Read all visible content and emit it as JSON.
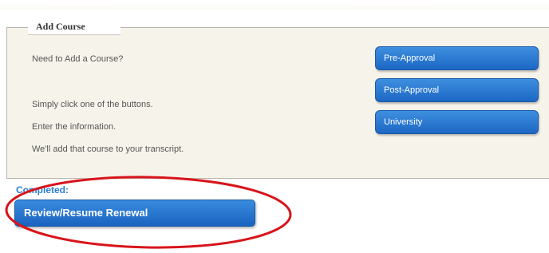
{
  "add_course": {
    "legend": "Add Course",
    "prompt": "Need to Add a Course?",
    "instructions": [
      "Simply click one of the buttons.",
      "Enter the information.",
      "We'll add that course to your transcript."
    ],
    "buttons": {
      "pre_approval": "Pre-Approval",
      "post_approval": "Post-Approval",
      "university": "University"
    }
  },
  "completed": {
    "label": "Completed:",
    "review_button": "Review/Resume Renewal"
  },
  "colors": {
    "button_blue": "#1c67c4",
    "completed_label": "#2a7fd4",
    "highlight_ellipse": "#d8141b"
  }
}
